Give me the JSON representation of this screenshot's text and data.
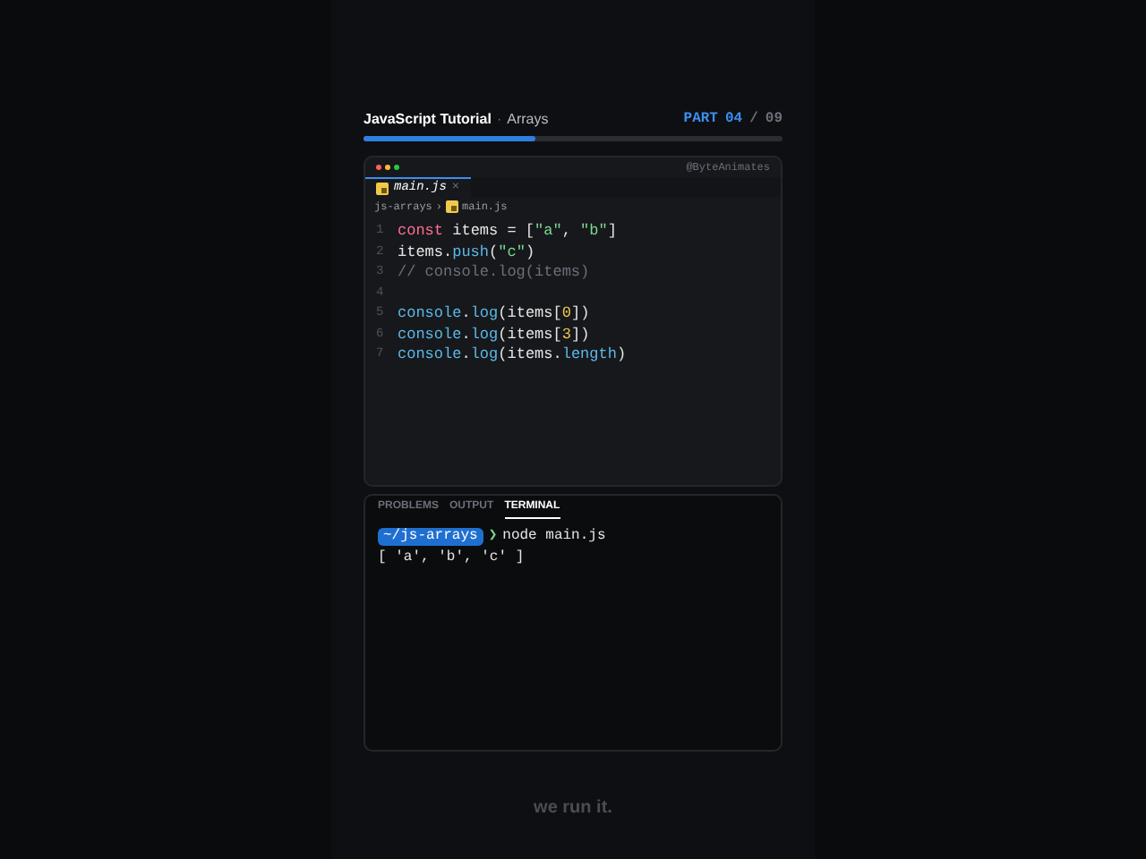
{
  "header": {
    "title": "JavaScript Tutorial",
    "separator": "·",
    "subtitle": "Arrays",
    "part_label": "PART",
    "part_current": "04",
    "part_divider": "/",
    "part_total": "09",
    "progress": {
      "level": 0.41
    }
  },
  "editor": {
    "watermark": "@ByteAnimates",
    "tab": {
      "label": "main.js",
      "close": "×",
      "selected": true
    },
    "breadcrumb": [
      "js-arrays",
      "›",
      "main.js"
    ],
    "lines": [
      {
        "number": "1",
        "tokens": [
          {
            "kind": "keyword",
            "text": "const"
          },
          {
            "kind": "plain",
            "text": " items = ["
          },
          {
            "kind": "string",
            "text": "\"a\""
          },
          {
            "kind": "plain",
            "text": ", "
          },
          {
            "kind": "string",
            "text": "\"b\""
          },
          {
            "kind": "plain",
            "text": "]"
          }
        ]
      },
      {
        "number": "2",
        "tokens": [
          {
            "kind": "plain",
            "text": "items."
          },
          {
            "kind": "method",
            "text": "push"
          },
          {
            "kind": "plain",
            "text": "("
          },
          {
            "kind": "string",
            "text": "\"c\""
          },
          {
            "kind": "plain",
            "text": ")"
          }
        ]
      },
      {
        "number": "3",
        "tokens": [
          {
            "kind": "comment",
            "text": "// console.log(items)"
          }
        ]
      },
      {
        "number": "4"
      },
      {
        "number": "5",
        "tokens": [
          {
            "kind": "method",
            "text": "console"
          },
          {
            "kind": "plain",
            "text": "."
          },
          {
            "kind": "method",
            "text": "log"
          },
          {
            "kind": "plain",
            "text": "(items["
          },
          {
            "kind": "number",
            "text": "0"
          },
          {
            "kind": "plain",
            "text": "])"
          }
        ]
      },
      {
        "number": "6",
        "tokens": [
          {
            "kind": "method",
            "text": "console"
          },
          {
            "kind": "plain",
            "text": "."
          },
          {
            "kind": "method",
            "text": "log"
          },
          {
            "kind": "plain",
            "text": "(items["
          },
          {
            "kind": "number",
            "text": "3"
          },
          {
            "kind": "plain",
            "text": "])"
          }
        ]
      },
      {
        "number": "7",
        "tokens": [
          {
            "kind": "method",
            "text": "console"
          },
          {
            "kind": "plain",
            "text": "."
          },
          {
            "kind": "method",
            "text": "log"
          },
          {
            "kind": "plain",
            "text": "(items."
          },
          {
            "kind": "method",
            "text": "length"
          },
          {
            "kind": "plain",
            "text": ")"
          }
        ]
      }
    ]
  },
  "panel": {
    "tabs": [
      {
        "label": "PROBLEMS",
        "selected": false
      },
      {
        "label": "OUTPUT",
        "selected": false
      },
      {
        "label": "TERMINAL",
        "selected": true
      }
    ],
    "prompt": {
      "path": "~/js-arrays",
      "arrow": "❯",
      "command": "node main.js"
    },
    "output": [
      "[ 'a', 'b', 'c' ]"
    ]
  },
  "caption": "we run it."
}
